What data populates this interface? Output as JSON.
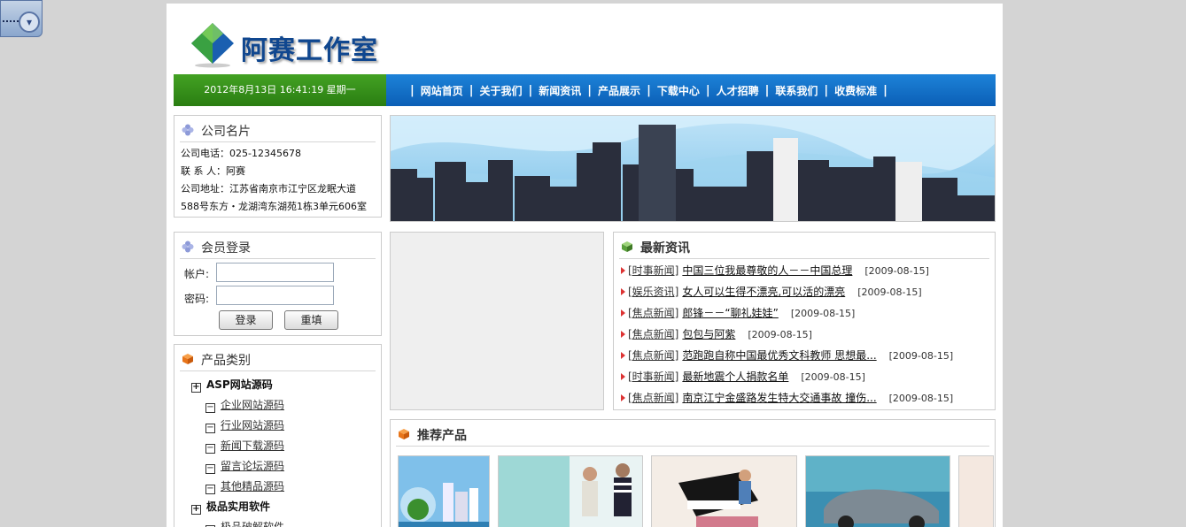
{
  "desktop_widget": {
    "icon": "network-icon",
    "chevron": "▾"
  },
  "header": {
    "logo_text": "阿赛工作室"
  },
  "navbar": {
    "datetime": "2012年8月13日 16:41:19 星期一",
    "separator": "|",
    "items": [
      "网站首页",
      "关于我们",
      "新闻资讯",
      "产品展示",
      "下载中心",
      "人才招聘",
      "联系我们",
      "收费标准"
    ]
  },
  "company_card": {
    "title": "公司名片",
    "phone": "公司电话：025-12345678",
    "contact": "联 系 人：阿赛",
    "address1": "公司地址：江苏省南京市江宁区龙眠大道",
    "address2": "588号东方・龙湖湾东湖苑1栋3单元606室"
  },
  "login": {
    "title": "会员登录",
    "account_label": "帐户:",
    "password_label": "密码:",
    "account_value": "",
    "password_value": "",
    "login_button": "登录",
    "reset_button": "重填"
  },
  "categories": {
    "title": "产品类别",
    "items": [
      {
        "label": "ASP网站源码",
        "level": 1,
        "toggle": "+"
      },
      {
        "label": "企业网站源码",
        "level": 2,
        "toggle": "−"
      },
      {
        "label": "行业网站源码",
        "level": 2,
        "toggle": "−"
      },
      {
        "label": "新闻下载源码",
        "level": 2,
        "toggle": "−"
      },
      {
        "label": "留言论坛源码",
        "level": 2,
        "toggle": "−"
      },
      {
        "label": "其他精品源码",
        "level": 2,
        "toggle": "−"
      },
      {
        "label": "极品实用软件",
        "level": 1,
        "toggle": "+"
      },
      {
        "label": "极品破解软件",
        "level": 2,
        "toggle": "−"
      }
    ]
  },
  "news": {
    "title": "最新资讯",
    "items": [
      {
        "category": "[时事新闻]",
        "title": "中国三位我最尊敬的人－－中国总理",
        "date": "[2009-08-15]"
      },
      {
        "category": "[娱乐资讯]",
        "title": "女人可以生得不漂亮,可以活的漂亮",
        "date": "[2009-08-15]"
      },
      {
        "category": "[焦点新闻]",
        "title": "郎锋－－“聊礼娃娃”",
        "date": "[2009-08-15]"
      },
      {
        "category": "[焦点新闻]",
        "title": "包包与阿紫",
        "date": "[2009-08-15]"
      },
      {
        "category": "[焦点新闻]",
        "title": "范跑跑自称中国最优秀文科教师 思想最...",
        "date": "[2009-08-15]"
      },
      {
        "category": "[时事新闻]",
        "title": "最新地震个人捐款名单",
        "date": "[2009-08-15]"
      },
      {
        "category": "[焦点新闻]",
        "title": "南京江宁金盛路发生特大交通事故 撞伤...",
        "date": "[2009-08-15]"
      }
    ]
  },
  "products": {
    "title": "推荐产品"
  },
  "colors": {
    "nav_blue": "#0b5fb6",
    "date_green": "#2a7e12",
    "logo_blue": "#10478f",
    "arrow_red": "#d33333",
    "cube_orange": "#e8751a",
    "cube_green": "#5aa03c"
  }
}
